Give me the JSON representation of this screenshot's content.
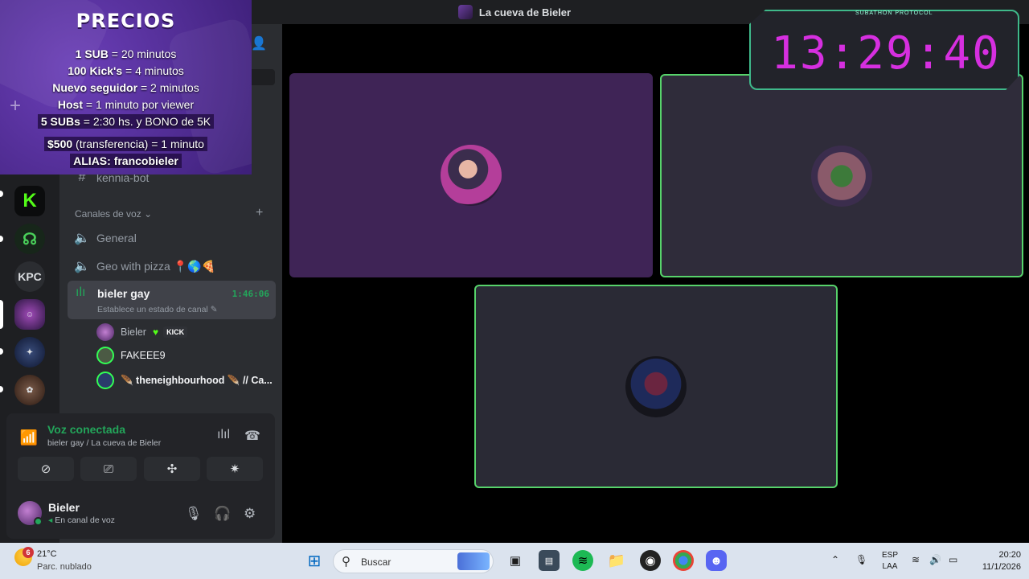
{
  "window": {
    "title": "La cueva de Bieler"
  },
  "servers": [
    {
      "label": "",
      "icon": "kick-icon"
    },
    {
      "label": "",
      "icon": "alien-icon"
    },
    {
      "label": "KPC",
      "icon": ""
    },
    {
      "label": "",
      "icon": "bieler-server-icon"
    },
    {
      "label": "",
      "icon": "server-icon"
    },
    {
      "label": "",
      "icon": "server-icon"
    }
  ],
  "channels": {
    "text_partial": "kennia-bot",
    "voice_section_label": "Canales de voz",
    "voice": [
      {
        "name": "General"
      },
      {
        "name": "Geo with pizza 📍🌎🍕"
      }
    ],
    "active": {
      "name": "bieler gay",
      "timer": "1:46:06",
      "status": "Establece un estado de canal"
    },
    "members": [
      {
        "name": "Bieler",
        "badge": "KICK"
      },
      {
        "name": "FAKEEE9"
      },
      {
        "name": "🪶 theneighbourhood 🪶 // Ca..."
      }
    ]
  },
  "voice_panel": {
    "title": "Voz conectada",
    "subtitle": "bieler gay / La cueva de Bieler"
  },
  "user_panel": {
    "name": "Bieler",
    "status": "En canal de voz"
  },
  "overlay": {
    "title": "PRECIOS",
    "lines": [
      {
        "bold": "1 SUB",
        "rest": " = 20 minutos"
      },
      {
        "bold": "100 Kick's",
        "rest": " = 4 minutos"
      },
      {
        "bold": "Nuevo seguidor",
        "rest": " = 2 minutos"
      },
      {
        "bold": "Host",
        "rest": " = 1 minuto por viewer"
      },
      {
        "bold": "5 SUBs",
        "rest": " = 2:30 hs. y BONO de 5K"
      },
      {
        "bold": "$500",
        "rest": " (transferencia) = 1 minuto"
      },
      {
        "bold": "ALIAS: francobieler",
        "rest": ""
      }
    ]
  },
  "subathon": {
    "label": "SUBATHON PROTOCOL",
    "time": "13:29:40"
  },
  "colors": {
    "accent_green": "#23a55a",
    "tile_purple": "#3f2456",
    "tile_dark": "#2f2c3a",
    "tile_border": "#57d36b",
    "timer_magenta": "#d62fe0"
  },
  "taskbar": {
    "weather_badge": "6",
    "weather_temp": "21°C",
    "weather_desc": "Parc. nublado",
    "search_placeholder": "Buscar",
    "lang_top": "ESP",
    "lang_bottom": "LAA",
    "time": "20:20",
    "date": "11/1/2026"
  }
}
